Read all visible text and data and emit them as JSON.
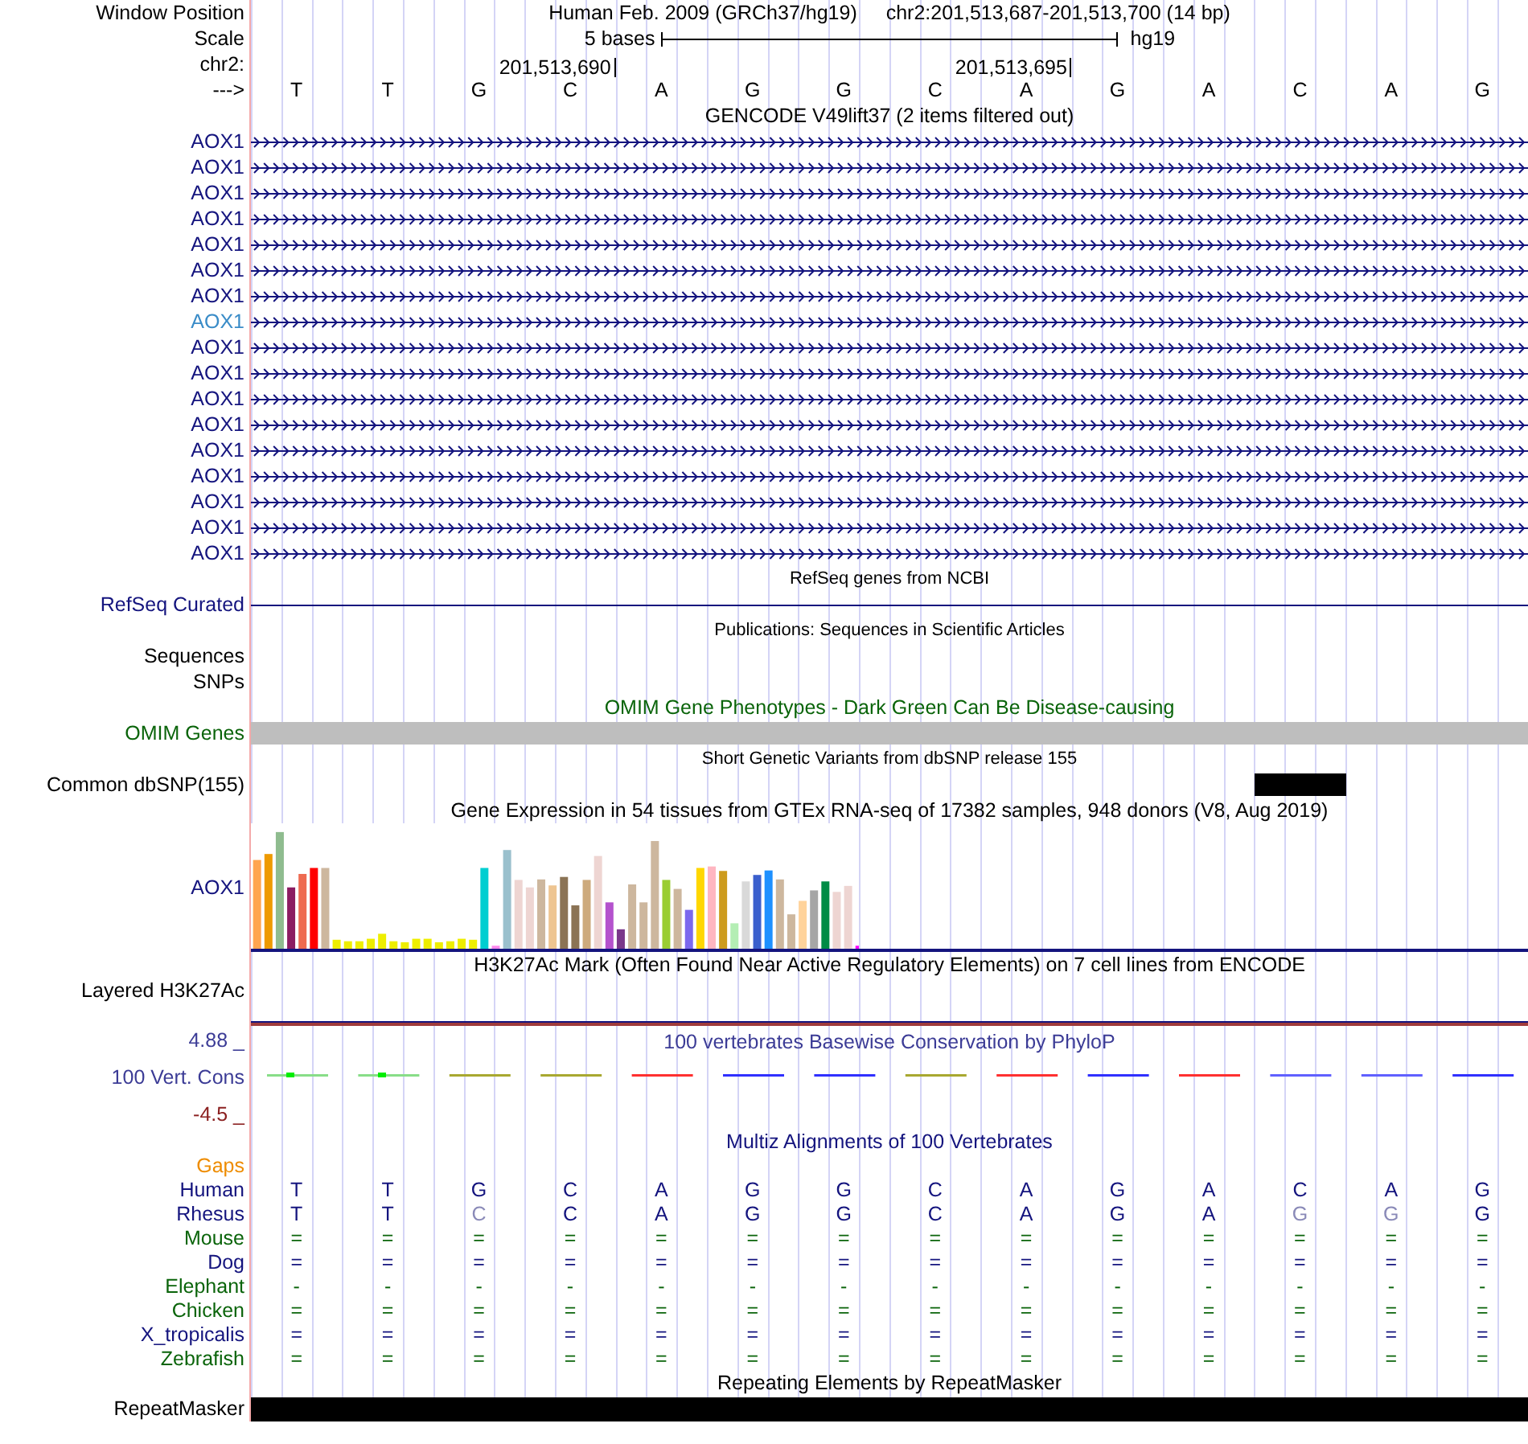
{
  "header": {
    "window_position_label": "Window Position",
    "assembly": "Human Feb. 2009 (GRCh37/hg19)",
    "position": "chr2:201,513,687-201,513,700 (14 bp)",
    "scale_label": "Scale",
    "scale_text": "5 bases",
    "scale_db": "hg19",
    "chrom_label": "chr2:",
    "ticks": [
      "201,513,690",
      "201,513,695"
    ],
    "strand_label": "--->",
    "bases": [
      "T",
      "T",
      "G",
      "C",
      "A",
      "G",
      "G",
      "C",
      "A",
      "G",
      "A",
      "C",
      "A",
      "G"
    ]
  },
  "tracks": [
    {
      "kind": "gene",
      "title": "GENCODE V49lift37 (2 items filtered out)",
      "color": "#14147e",
      "items": [
        {
          "label": "AOX1",
          "highlighted": false
        },
        {
          "label": "AOX1",
          "highlighted": false
        },
        {
          "label": "AOX1",
          "highlighted": false
        },
        {
          "label": "AOX1",
          "highlighted": false
        },
        {
          "label": "AOX1",
          "highlighted": false
        },
        {
          "label": "AOX1",
          "highlighted": false
        },
        {
          "label": "AOX1",
          "highlighted": false
        },
        {
          "label": "AOX1",
          "highlighted": true
        },
        {
          "label": "AOX1",
          "highlighted": false
        },
        {
          "label": "AOX1",
          "highlighted": false
        },
        {
          "label": "AOX1",
          "highlighted": false
        },
        {
          "label": "AOX1",
          "highlighted": false
        },
        {
          "label": "AOX1",
          "highlighted": false
        },
        {
          "label": "AOX1",
          "highlighted": false
        },
        {
          "label": "AOX1",
          "highlighted": false
        },
        {
          "label": "AOX1",
          "highlighted": false
        },
        {
          "label": "AOX1",
          "highlighted": false
        }
      ]
    },
    {
      "kind": "line",
      "title": "RefSeq genes from NCBI",
      "label": "RefSeq Curated",
      "color": "#14147e"
    },
    {
      "kind": "labels",
      "title": "Publications: Sequences in Scientific Articles",
      "labels": [
        "Sequences",
        "SNPs"
      ],
      "color": "#000000"
    },
    {
      "kind": "bar",
      "title": "OMIM Gene Phenotypes - Dark Green Can Be Disease-causing",
      "label": "OMIM Genes",
      "color": "#0a640a"
    },
    {
      "kind": "snp",
      "title": "Short Genetic Variants from dbSNP release 155",
      "label": "Common dbSNP(155)",
      "color": "#000000"
    },
    {
      "kind": "expression",
      "title": "Gene Expression in 54 tissues from GTEx RNA-seq of 17382 samples, 948 donors (V8, Aug 2019)",
      "label": "AOX1",
      "color": "#14147e"
    },
    {
      "kind": "layered",
      "title": "H3K27Ac Mark (Often Found Near Active Regulatory Elements) on 7 cell lines from ENCODE",
      "label": "Layered H3K27Ac",
      "color": "#000000"
    },
    {
      "kind": "conservation",
      "title": "100 vertebrates Basewise Conservation by PhyloP",
      "label": "100 Vert. Cons",
      "max": "4.88 _",
      "min": "-4.5 _",
      "color": "#3c3c96"
    },
    {
      "kind": "multiz",
      "title": "Multiz Alignments of 100 Vertebrates",
      "color": "#14147e",
      "species": [
        {
          "name": "Gaps",
          "color": "#ee8c00"
        },
        {
          "name": "Human",
          "color": "#14147e",
          "cells": [
            {
              "text": "T",
              "mismatch": false
            },
            {
              "text": "T",
              "mismatch": false
            },
            {
              "text": "G",
              "mismatch": false
            },
            {
              "text": "C",
              "mismatch": false
            },
            {
              "text": "A",
              "mismatch": false
            },
            {
              "text": "G",
              "mismatch": false
            },
            {
              "text": "G",
              "mismatch": false
            },
            {
              "text": "C",
              "mismatch": false
            },
            {
              "text": "A",
              "mismatch": false
            },
            {
              "text": "G",
              "mismatch": false
            },
            {
              "text": "A",
              "mismatch": false
            },
            {
              "text": "C",
              "mismatch": false
            },
            {
              "text": "A",
              "mismatch": false
            },
            {
              "text": "G",
              "mismatch": false
            }
          ]
        },
        {
          "name": "Rhesus",
          "color": "#14147e",
          "cells": [
            {
              "text": "T",
              "mismatch": false
            },
            {
              "text": "T",
              "mismatch": false
            },
            {
              "text": "C",
              "mismatch": true
            },
            {
              "text": "C",
              "mismatch": false
            },
            {
              "text": "A",
              "mismatch": false
            },
            {
              "text": "G",
              "mismatch": false
            },
            {
              "text": "G",
              "mismatch": false
            },
            {
              "text": "C",
              "mismatch": false
            },
            {
              "text": "A",
              "mismatch": false
            },
            {
              "text": "G",
              "mismatch": false
            },
            {
              "text": "A",
              "mismatch": false
            },
            {
              "text": "G",
              "mismatch": true
            },
            {
              "text": "G",
              "mismatch": true
            },
            {
              "text": "G",
              "mismatch": false
            }
          ]
        },
        {
          "name": "Mouse",
          "color": "#0a640a",
          "cells": [
            {
              "text": "=",
              "mismatch": false
            },
            {
              "text": "=",
              "mismatch": false
            },
            {
              "text": "=",
              "mismatch": false
            },
            {
              "text": "=",
              "mismatch": false
            },
            {
              "text": "=",
              "mismatch": false
            },
            {
              "text": "=",
              "mismatch": false
            },
            {
              "text": "=",
              "mismatch": false
            },
            {
              "text": "=",
              "mismatch": false
            },
            {
              "text": "=",
              "mismatch": false
            },
            {
              "text": "=",
              "mismatch": false
            },
            {
              "text": "=",
              "mismatch": false
            },
            {
              "text": "=",
              "mismatch": false
            },
            {
              "text": "=",
              "mismatch": false
            },
            {
              "text": "=",
              "mismatch": false
            }
          ]
        },
        {
          "name": "Dog",
          "color": "#14147e",
          "cells": [
            {
              "text": "=",
              "mismatch": false
            },
            {
              "text": "=",
              "mismatch": false
            },
            {
              "text": "=",
              "mismatch": false
            },
            {
              "text": "=",
              "mismatch": false
            },
            {
              "text": "=",
              "mismatch": false
            },
            {
              "text": "=",
              "mismatch": false
            },
            {
              "text": "=",
              "mismatch": false
            },
            {
              "text": "=",
              "mismatch": false
            },
            {
              "text": "=",
              "mismatch": false
            },
            {
              "text": "=",
              "mismatch": false
            },
            {
              "text": "=",
              "mismatch": false
            },
            {
              "text": "=",
              "mismatch": false
            },
            {
              "text": "=",
              "mismatch": false
            },
            {
              "text": "=",
              "mismatch": false
            }
          ]
        },
        {
          "name": "Elephant",
          "color": "#0a640a",
          "cells": [
            {
              "text": "-",
              "mismatch": false
            },
            {
              "text": "-",
              "mismatch": false
            },
            {
              "text": "-",
              "mismatch": false
            },
            {
              "text": "-",
              "mismatch": false
            },
            {
              "text": "-",
              "mismatch": false
            },
            {
              "text": "-",
              "mismatch": false
            },
            {
              "text": "-",
              "mismatch": false
            },
            {
              "text": "-",
              "mismatch": false
            },
            {
              "text": "-",
              "mismatch": false
            },
            {
              "text": "-",
              "mismatch": false
            },
            {
              "text": "-",
              "mismatch": false
            },
            {
              "text": "-",
              "mismatch": false
            },
            {
              "text": "-",
              "mismatch": false
            },
            {
              "text": "-",
              "mismatch": false
            }
          ]
        },
        {
          "name": "Chicken",
          "color": "#0a640a",
          "cells": [
            {
              "text": "=",
              "mismatch": false
            },
            {
              "text": "=",
              "mismatch": false
            },
            {
              "text": "=",
              "mismatch": false
            },
            {
              "text": "=",
              "mismatch": false
            },
            {
              "text": "=",
              "mismatch": false
            },
            {
              "text": "=",
              "mismatch": false
            },
            {
              "text": "=",
              "mismatch": false
            },
            {
              "text": "=",
              "mismatch": false
            },
            {
              "text": "=",
              "mismatch": false
            },
            {
              "text": "=",
              "mismatch": false
            },
            {
              "text": "=",
              "mismatch": false
            },
            {
              "text": "=",
              "mismatch": false
            },
            {
              "text": "=",
              "mismatch": false
            },
            {
              "text": "=",
              "mismatch": false
            }
          ]
        },
        {
          "name": "X_tropicalis",
          "color": "#14147e",
          "cells": [
            {
              "text": "=",
              "mismatch": false
            },
            {
              "text": "=",
              "mismatch": false
            },
            {
              "text": "=",
              "mismatch": false
            },
            {
              "text": "=",
              "mismatch": false
            },
            {
              "text": "=",
              "mismatch": false
            },
            {
              "text": "=",
              "mismatch": false
            },
            {
              "text": "=",
              "mismatch": false
            },
            {
              "text": "=",
              "mismatch": false
            },
            {
              "text": "=",
              "mismatch": false
            },
            {
              "text": "=",
              "mismatch": false
            },
            {
              "text": "=",
              "mismatch": false
            },
            {
              "text": "=",
              "mismatch": false
            },
            {
              "text": "=",
              "mismatch": false
            },
            {
              "text": "=",
              "mismatch": false
            }
          ]
        },
        {
          "name": "Zebrafish",
          "color": "#0a640a",
          "cells": [
            {
              "text": "=",
              "mismatch": false
            },
            {
              "text": "=",
              "mismatch": false
            },
            {
              "text": "=",
              "mismatch": false
            },
            {
              "text": "=",
              "mismatch": false
            },
            {
              "text": "=",
              "mismatch": false
            },
            {
              "text": "=",
              "mismatch": false
            },
            {
              "text": "=",
              "mismatch": false
            },
            {
              "text": "=",
              "mismatch": false
            },
            {
              "text": "=",
              "mismatch": false
            },
            {
              "text": "=",
              "mismatch": false
            },
            {
              "text": "=",
              "mismatch": false
            },
            {
              "text": "=",
              "mismatch": false
            },
            {
              "text": "=",
              "mismatch": false
            },
            {
              "text": "=",
              "mismatch": false
            }
          ]
        }
      ]
    },
    {
      "kind": "repeat",
      "title": "Repeating Elements by RepeatMasker",
      "label": "RepeatMasker",
      "color": "#000000"
    }
  ]
}
